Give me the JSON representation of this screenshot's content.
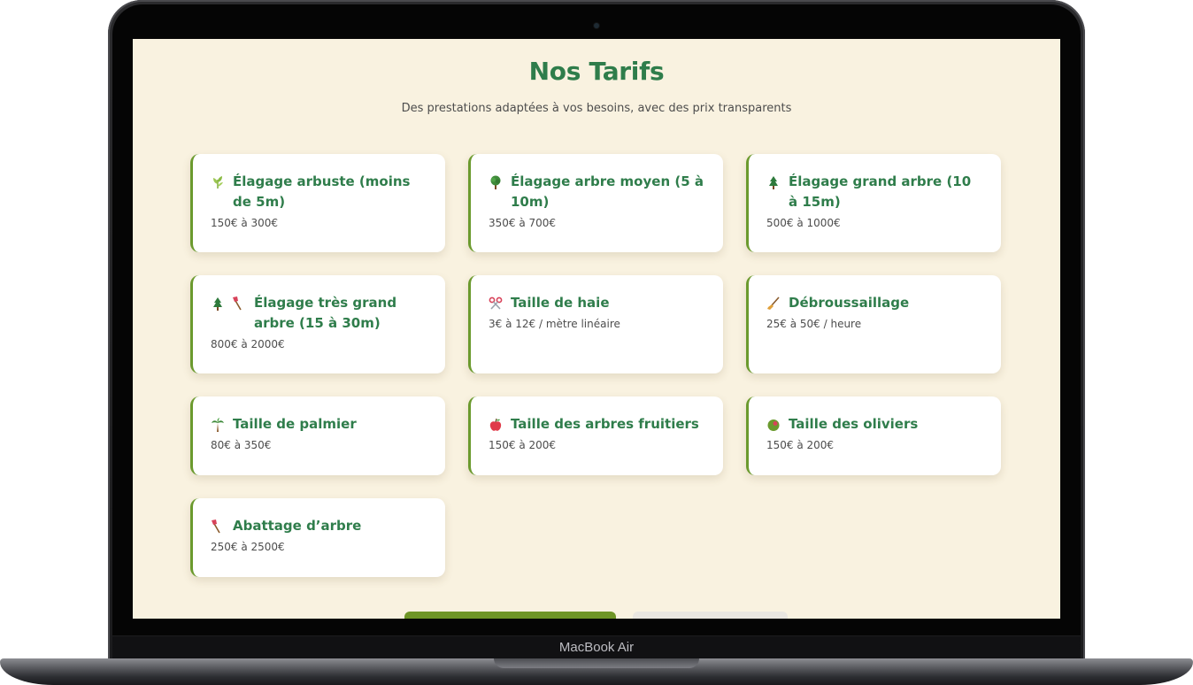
{
  "device": {
    "model_label": "MacBook Air"
  },
  "page": {
    "title": "Nos Tarifs",
    "subtitle": "Des prestations adaptées à vos besoins, avec des prix transparents"
  },
  "pricing_cards": [
    {
      "icon": "herb-icon",
      "title": "Élagage arbuste (moins de 5m)",
      "price": "150€ à 300€"
    },
    {
      "icon": "deciduous-tree-icon",
      "title": "Élagage arbre moyen (5 à 10m)",
      "price": "350€ à 700€"
    },
    {
      "icon": "evergreen-tree-icon",
      "title": "Élagage grand arbre (10 à 15m)",
      "price": "500€ à 1000€"
    },
    {
      "icon": "evergreen-tree-axe-icon",
      "title": "Élagage très grand arbre (15 à 30m)",
      "price": "800€ à 2000€"
    },
    {
      "icon": "scissors-icon",
      "title": "Taille de haie",
      "price": "3€ à 12€ / mètre linéaire"
    },
    {
      "icon": "broom-icon",
      "title": "Débroussaillage",
      "price": "25€ à 50€ / heure"
    },
    {
      "icon": "palm-tree-icon",
      "title": "Taille de palmier",
      "price": "80€ à 350€"
    },
    {
      "icon": "apple-icon",
      "title": "Taille des arbres fruitiers",
      "price": "150€ à 200€"
    },
    {
      "icon": "olive-icon",
      "title": "Taille des oliviers",
      "price": "150€ à 200€"
    },
    {
      "icon": "axe-icon",
      "title": "Abattage d’arbre",
      "price": "250€ à 2500€"
    }
  ],
  "colors": {
    "accent_green": "#2f7d4b",
    "card_border": "#6b9a2e",
    "page_background": "#f9f2e0",
    "primary_button": "#6e9526"
  }
}
